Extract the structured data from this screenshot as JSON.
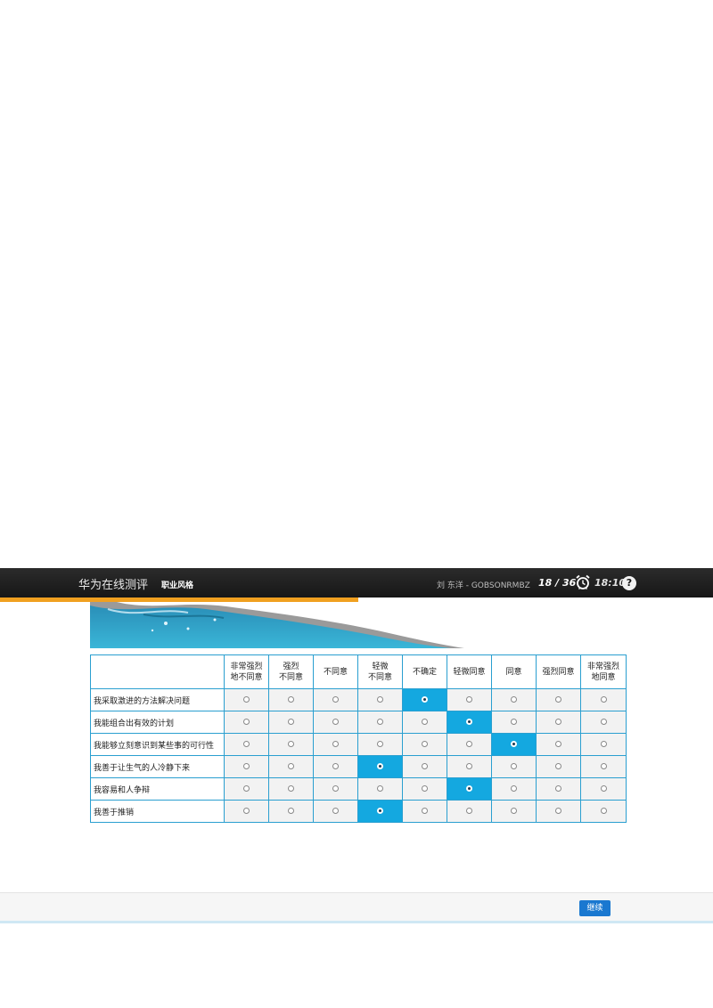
{
  "header": {
    "app_title": "华为在线测评",
    "section": "职业风格",
    "user": "刘 东洋 - GOBSONRMBZ",
    "progress": "18 / 36",
    "timer": "18:10",
    "help": "?"
  },
  "options": [
    "非常强烈\n地不同意",
    "强烈\n不同意",
    "不同意",
    "轻微\n不同意",
    "不确定",
    "轻微同意",
    "同意",
    "强烈同意",
    "非常强烈\n地同意"
  ],
  "questions": [
    {
      "text": "我采取激进的方法解决问题",
      "selected": 4
    },
    {
      "text": "我能组合出有效的计划",
      "selected": 5
    },
    {
      "text": "我能够立刻意识到某些事的可行性",
      "selected": 6
    },
    {
      "text": "我善于让生气的人冷静下来",
      "selected": 3
    },
    {
      "text": "我容易和人争辩",
      "selected": 5
    },
    {
      "text": "我善于推销",
      "selected": 3
    }
  ],
  "footer": {
    "continue_label": "继续"
  },
  "colors": {
    "accent": "#14a8e0",
    "header_bg": "#1f1f1f",
    "orange_bar": "#f0a020",
    "button": "#1a78d0"
  }
}
